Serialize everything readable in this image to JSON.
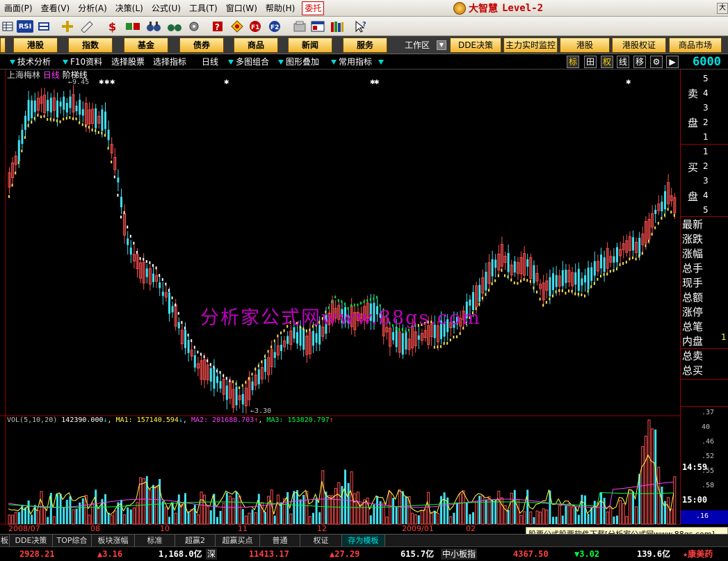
{
  "menu": {
    "items": [
      "画面(P)",
      "查看(V)",
      "分析(A)",
      "决策(L)",
      "公式(U)",
      "工具(T)",
      "窗口(W)",
      "帮助(H)"
    ],
    "weituo": "委托",
    "brand_name": "大智慧",
    "brand_level": "Level-2",
    "scroll_right": "大"
  },
  "toolbar": {
    "icons": [
      "grid-icon",
      "rsi-icon",
      "table-icon",
      "crosshair-icon",
      "ruler-icon",
      "dollar-icon",
      "compare-icon",
      "binoculars-icon",
      "help-query-icon",
      "diamond-icon",
      "f10-icon",
      "disk-icon",
      "folder-icon",
      "window-icon",
      "books-icon",
      "help-pointer-icon"
    ],
    "rsi_label": "RSI"
  },
  "nav": {
    "left_buttons": [
      "港股",
      "指数",
      "基金",
      "债券",
      "商品",
      "新闻",
      "服务"
    ],
    "workspace": "工作区",
    "right_buttons": [
      "DDE决策",
      "主力实时监控",
      "港股",
      "港股权证",
      "商品市场"
    ]
  },
  "tools": {
    "items": [
      "技术分析",
      "F10资料",
      "选择股票",
      "选择指标",
      "日线",
      "多图组合",
      "图形叠加",
      "常用指标"
    ],
    "buttons": [
      "标",
      "田",
      "权",
      "线",
      "移",
      "⚙",
      "▶"
    ],
    "price_code": "6000"
  },
  "chart": {
    "stock_name": "上海梅林",
    "period": "日线",
    "indicator": "阶梯线",
    "high_label": "9.45",
    "low_label": "3.30",
    "watermark": "分析家公式网www.88gs.com",
    "dates": [
      "2008/07",
      "08",
      "10",
      "11",
      "12",
      "2009/01",
      "02"
    ]
  },
  "volume": {
    "label": "VOL(5,10,20)",
    "value": "142390.000",
    "value_dir": "↓",
    "ma1_label": "MA1:",
    "ma1": "157140.594",
    "ma1_dir": "↓",
    "ma2_label": "MA2:",
    "ma2": "201688.703",
    "ma2_dir": "↑",
    "ma3_label": "MA3:",
    "ma3": "153820.797",
    "ma3_dir": "↑"
  },
  "panel": {
    "sell_char1": "卖",
    "sell_char2": "盘",
    "sell_nums": [
      "5",
      "4",
      "3",
      "2",
      "1"
    ],
    "buy_char1": "买",
    "buy_char2": "盘",
    "buy_nums": [
      "1",
      "2",
      "3",
      "4",
      "5"
    ],
    "labels": [
      "最新",
      "涨跌",
      "涨幅",
      "总手",
      "现手",
      "总额",
      "涨停",
      "总笔",
      "内盘",
      "总卖",
      "总买"
    ],
    "one_value": "1",
    "time1": "14:59",
    "time2": "15:00",
    "ticks1": [
      ".37",
      "40",
      ".46",
      ".52",
      ".55",
      ".58"
    ],
    "tick_bottom": ".16"
  },
  "tabs": {
    "items": [
      "板",
      "DDE决策",
      "TOP综合",
      "板块涨幅",
      "标准",
      "超赢2",
      "超赢买点",
      "普通",
      "权证",
      "存为模板"
    ],
    "download": "股票公式股票软件下载[分析家公式网www.88gs.com]"
  },
  "status": {
    "sh_index": "2928.21",
    "sh_change": "▲3.16",
    "sh_amount": "1,168.0亿",
    "sz_label": "深",
    "sz_index": "11413.17",
    "sz_change": "▲27.29",
    "sz_amount": "615.7亿",
    "zxb_label": "中小板指",
    "zxb_index": "4367.50",
    "zxb_change": "▼3.02",
    "zxb_amount": "139.6亿",
    "ticker": "★康美药"
  }
}
